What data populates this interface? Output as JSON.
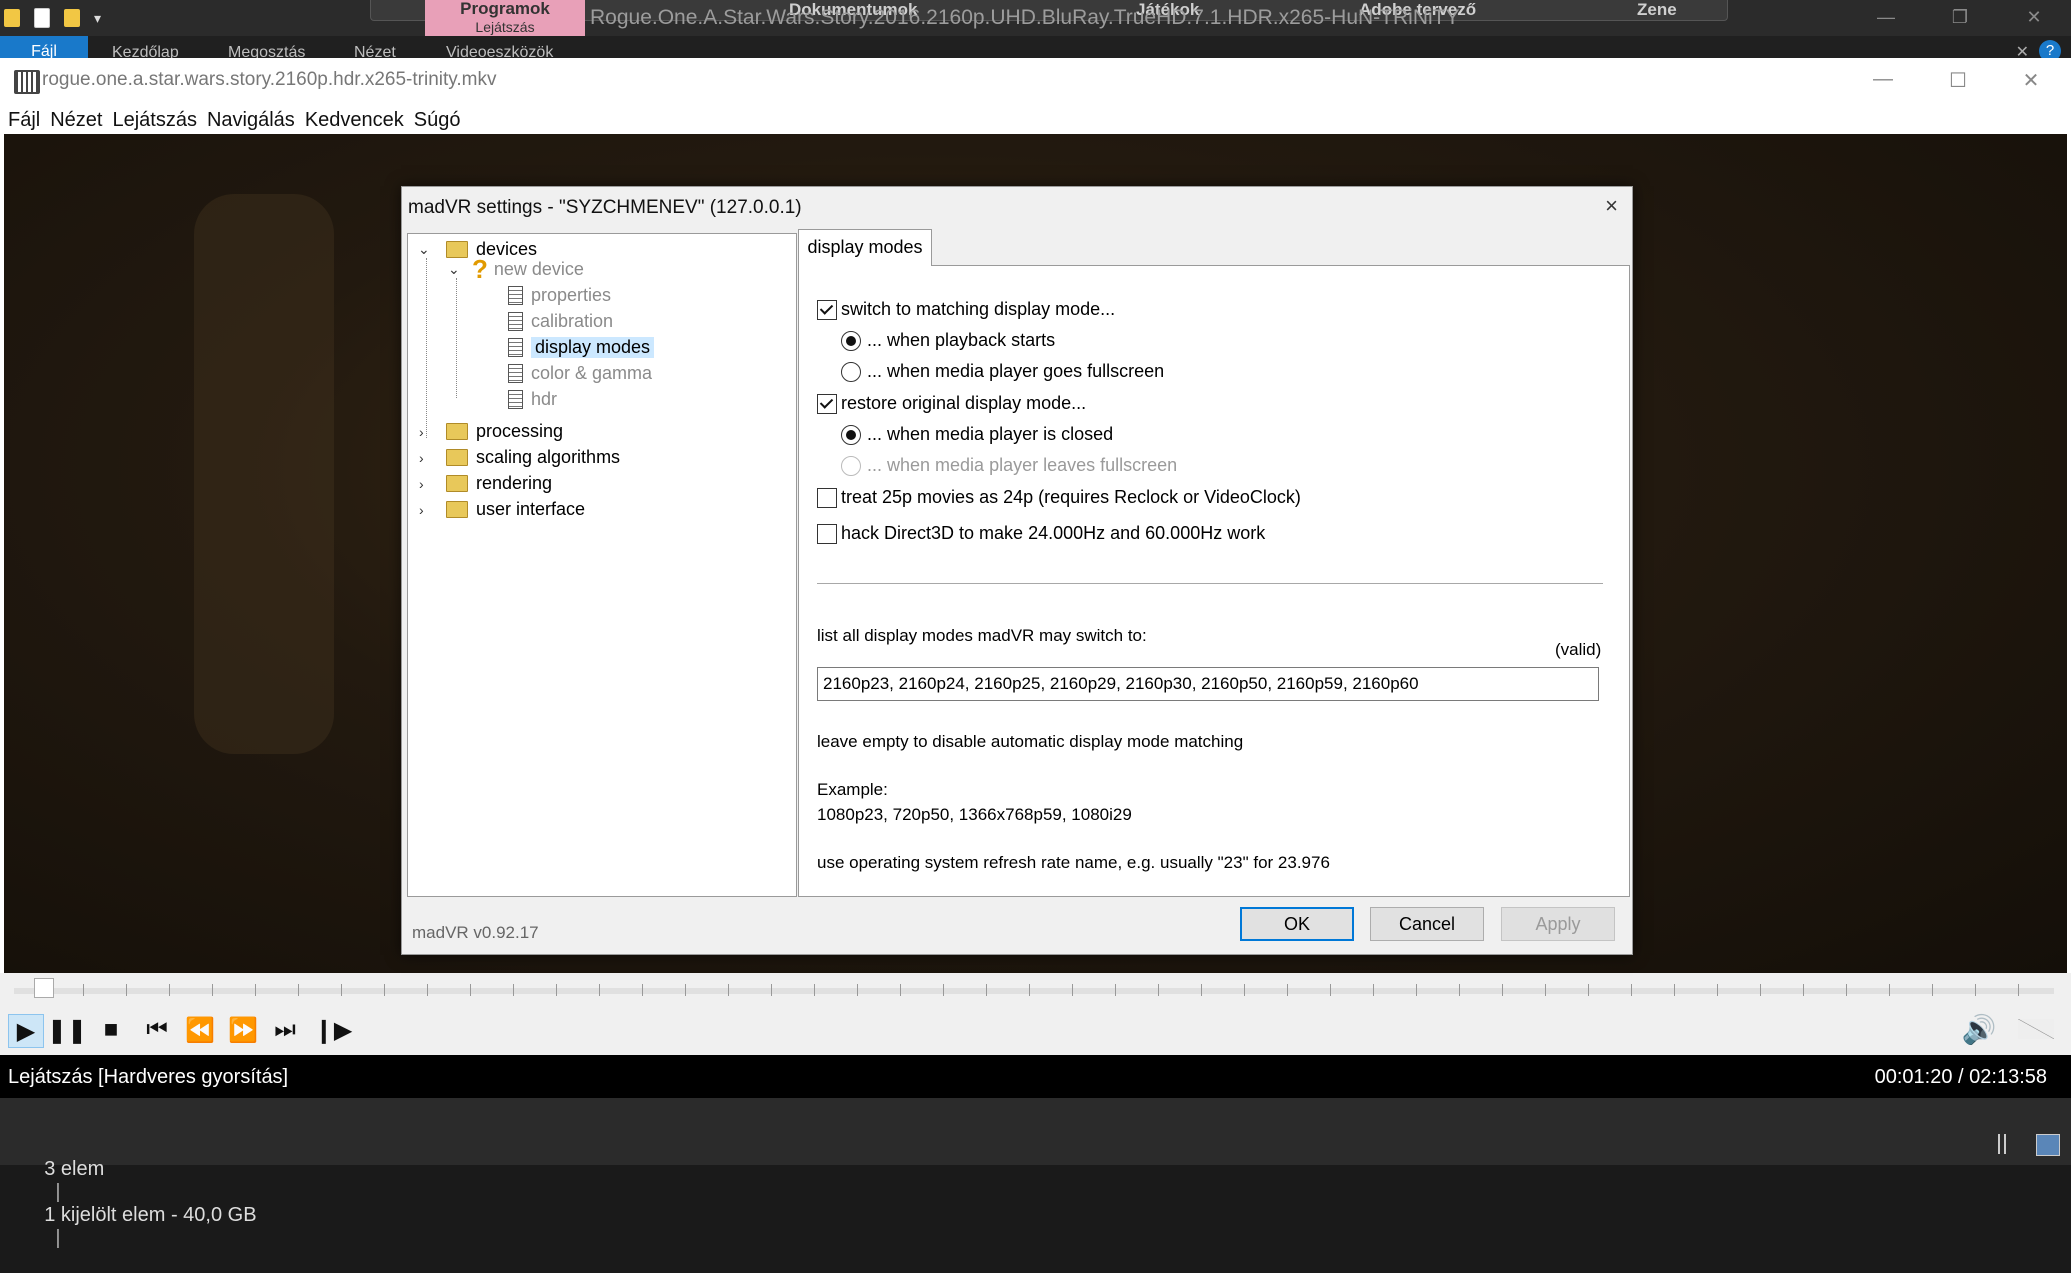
{
  "explorer": {
    "library_tabs": [
      "Programok",
      "Dokumentumok",
      "Játékok",
      "Adobe tervező",
      "Zene"
    ],
    "library_sub": "Lejátszás",
    "window_title": "Rogue.One.A.Star.Wars.Story.2016.2160p.UHD.BluRay.TrueHD.7.1.HDR.x265-HuN-TRiNiTY",
    "ribbon_tabs": [
      "Fájl",
      "Kezdőlap",
      "Megosztás",
      "Nézet",
      "Videoeszközök"
    ],
    "help_label": "?",
    "status": {
      "items": "3 elem",
      "selected": "1 kijelölt elem - 40,0 GB"
    }
  },
  "player": {
    "title": "rogue.one.a.star.wars.story.2160p.hdr.x265-trinity.mkv",
    "menu": [
      "Fájl",
      "Nézet",
      "Lejátszás",
      "Navigálás",
      "Kedvencek",
      "Súgó"
    ],
    "status_left": "Lejátszás [Hardveres gyorsítás]",
    "status_right": "00:01:20 / 02:13:58",
    "position_fraction": 0.01
  },
  "dialog": {
    "title": "madVR settings - \"SYZCHMENEV\" (127.0.0.1)",
    "close": "×",
    "tree": {
      "devices": "devices",
      "new_device": "new device",
      "properties": "properties",
      "calibration": "calibration",
      "display_modes": "display modes",
      "color_gamma": "color & gamma",
      "hdr": "hdr",
      "processing": "processing",
      "scaling": "scaling algorithms",
      "rendering": "rendering",
      "user_interface": "user interface"
    },
    "tab": "display modes",
    "options": {
      "switch_matching": "switch to matching display mode...",
      "when_playback_starts": "... when playback starts",
      "when_fullscreen": "... when media player goes fullscreen",
      "restore_original": "restore original display mode...",
      "when_closed": "... when media player is closed",
      "when_leaves_fullscreen": "... when media player leaves fullscreen",
      "treat_25p": "treat 25p movies as 24p  (requires Reclock or VideoClock)",
      "hack_d3d": "hack Direct3D to make 24.000Hz and 60.000Hz work"
    },
    "list_label": "list all display modes madVR may switch to:",
    "valid": "(valid)",
    "modes_value": "2160p23, 2160p24, 2160p25, 2160p29, 2160p30, 2160p50, 2160p59, 2160p60",
    "hint_empty": "leave empty to disable automatic display mode matching",
    "example_label": "Example:",
    "example_value": "1080p23, 720p50, 1366x768p59, 1080i29",
    "hint_refresh": "use operating system refresh rate name, e.g. usually \"23\" for 23.976",
    "version": "madVR v0.92.17",
    "buttons": {
      "ok": "OK",
      "cancel": "Cancel",
      "apply": "Apply"
    }
  }
}
